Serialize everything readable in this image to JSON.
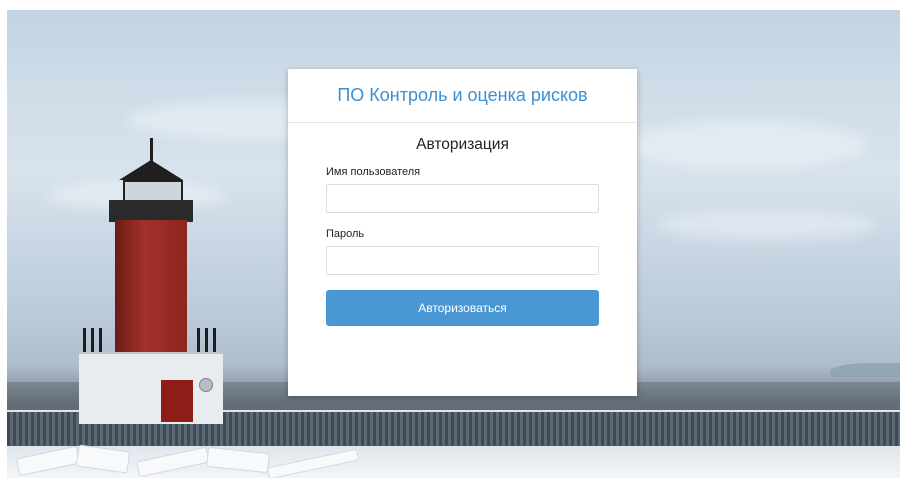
{
  "app": {
    "title": "ПО Контроль и оценка рисков"
  },
  "login_form": {
    "heading": "Авторизация",
    "username": {
      "label": "Имя пользователя",
      "value": "",
      "placeholder": ""
    },
    "password": {
      "label": "Пароль",
      "value": "",
      "placeholder": ""
    },
    "submit_label": "Авторизоваться"
  },
  "colors": {
    "accent": "#4a98d3",
    "title": "#3f8fcf",
    "lighthouse_red": "#a3302a"
  }
}
